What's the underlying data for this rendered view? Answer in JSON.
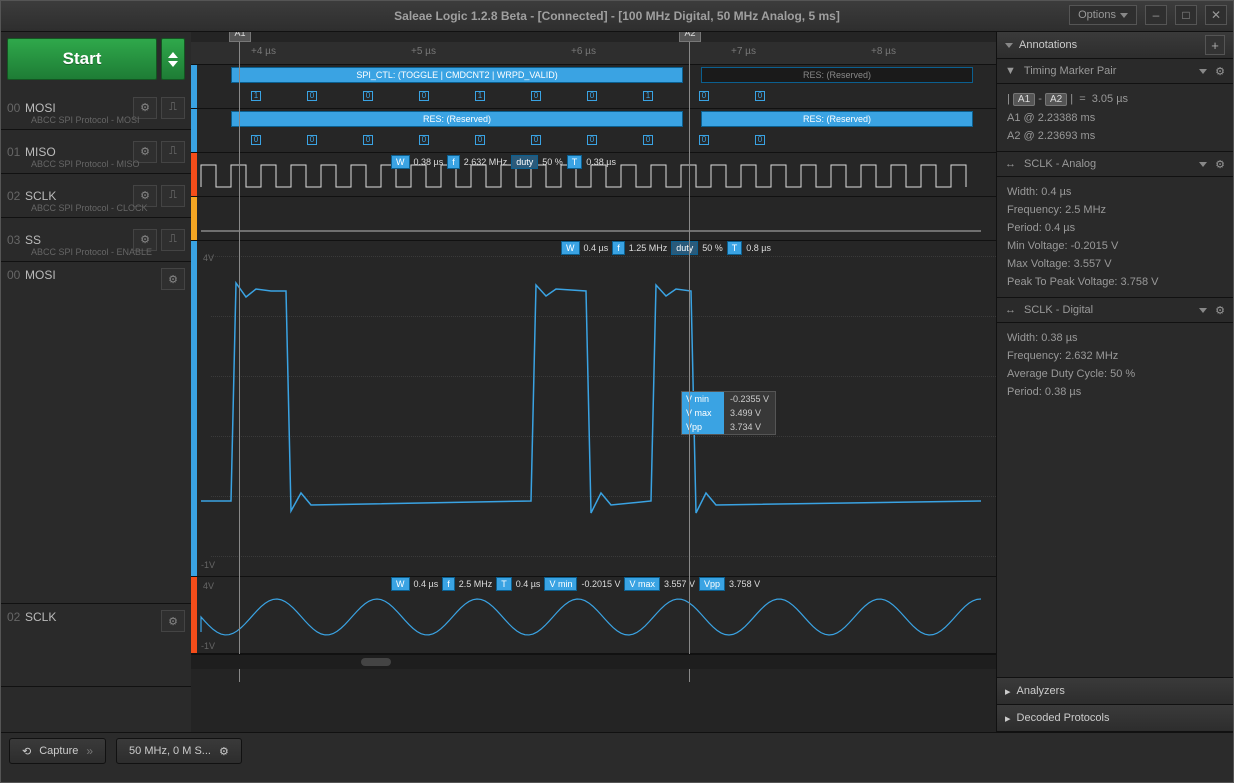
{
  "titlebar": {
    "title": "Saleae Logic 1.2.8 Beta - [Connected] - [100 MHz Digital, 50 MHz Analog, 5 ms]",
    "options_label": "Options"
  },
  "start_button": {
    "label": "Start"
  },
  "time_ticks": [
    "+4 µs",
    "+5 µs",
    "+6 µs",
    "+7 µs",
    "+8 µs"
  ],
  "markers": {
    "a1": "A1",
    "a2": "A2"
  },
  "channels_digital": [
    {
      "num": "00",
      "name": "MOSI",
      "sub": "ABCC SPI Protocol - MOSI",
      "color": "#3aa3e3"
    },
    {
      "num": "01",
      "name": "MISO",
      "sub": "ABCC SPI Protocol - MISO",
      "color": "#3aa3e3"
    },
    {
      "num": "02",
      "name": "SCLK",
      "sub": "ABCC SPI Protocol - CLOCK",
      "color": "#f54d1a"
    },
    {
      "num": "03",
      "name": "SS",
      "sub": "ABCC SPI Protocol - ENABLE",
      "color": "#f5a623"
    }
  ],
  "channels_analog": [
    {
      "num": "00",
      "name": "MOSI"
    },
    {
      "num": "02",
      "name": "SCLK"
    }
  ],
  "decode_mosi_top": "SPI_CTL: (TOGGLE | CMDCNT2 | WRPD_VALID)",
  "decode_mosi_res": "RES: (Reserved)",
  "decode_miso_res1": "RES: (Reserved)",
  "decode_miso_res2": "RES: (Reserved)",
  "bits_row1": [
    "1",
    "0",
    "0",
    "0",
    "1",
    "0",
    "0",
    "1",
    "0",
    "0"
  ],
  "bits_row2": [
    "0",
    "0",
    "0",
    "0",
    "0",
    "0",
    "0",
    "0",
    "0",
    "0"
  ],
  "sclk_meas": {
    "w": "0.38 µs",
    "f": "2.632 MHz",
    "duty": "50 %",
    "t": "0.38 µs"
  },
  "mosi_anal_meas": {
    "w": "0.4 µs",
    "f": "1.25 MHz",
    "duty": "50 %",
    "t": "0.8 µs"
  },
  "mosi_vbox": {
    "vmin": "-0.2355 V",
    "vmax": "3.499 V",
    "vpp": "3.734 V"
  },
  "mosi_ylabels": {
    "top": "4V",
    "bot": "-1V"
  },
  "sclk_anal_meas": {
    "w": "0.4 µs",
    "f": "2.5 MHz",
    "t": "0.4 µs",
    "vmin": "-0.2015 V",
    "vmax": "3.557 V",
    "vpp": "3.758 V"
  },
  "sclk_ylabels": {
    "top": "4V",
    "bot": "-1V"
  },
  "right": {
    "annotations_hdr": "Annotations",
    "tm_pair": "Timing Marker Pair",
    "tm_diff": "| A1 - A2 |  =  3.05 µs",
    "a1_line": "A1  @  2.23388 ms",
    "a2_line": "A2  @  2.23693 ms",
    "sclk_analog_hdr": "SCLK - Analog",
    "sclk_analog": {
      "width": "Width: 0.4 µs",
      "freq": "Frequency: 2.5 MHz",
      "period": "Period: 0.4 µs",
      "vmin": "Min Voltage: -0.2015 V",
      "vmax": "Max Voltage: 3.557 V",
      "vpp": "Peak To Peak Voltage: 3.758 V"
    },
    "sclk_digital_hdr": "SCLK - Digital",
    "sclk_digital": {
      "width": "Width: 0.38 µs",
      "freq": "Frequency: 2.632 MHz",
      "duty": "Average Duty Cycle: 50 %",
      "period": "Period: 0.38 µs"
    },
    "analyzers": "Analyzers",
    "decoded": "Decoded Protocols"
  },
  "footer": {
    "capture": "Capture",
    "settings": "50 MHz, 0 M S..."
  },
  "badge_labels": {
    "w": "W",
    "f": "f",
    "duty": "duty",
    "t": "T",
    "vmin": "V min",
    "vmax": "V max",
    "vpp": "Vpp"
  },
  "icons": {
    "gear": "⚙",
    "pulse": "⎍",
    "funnel": "▼",
    "arrows": "↔",
    "chev": "▸"
  }
}
